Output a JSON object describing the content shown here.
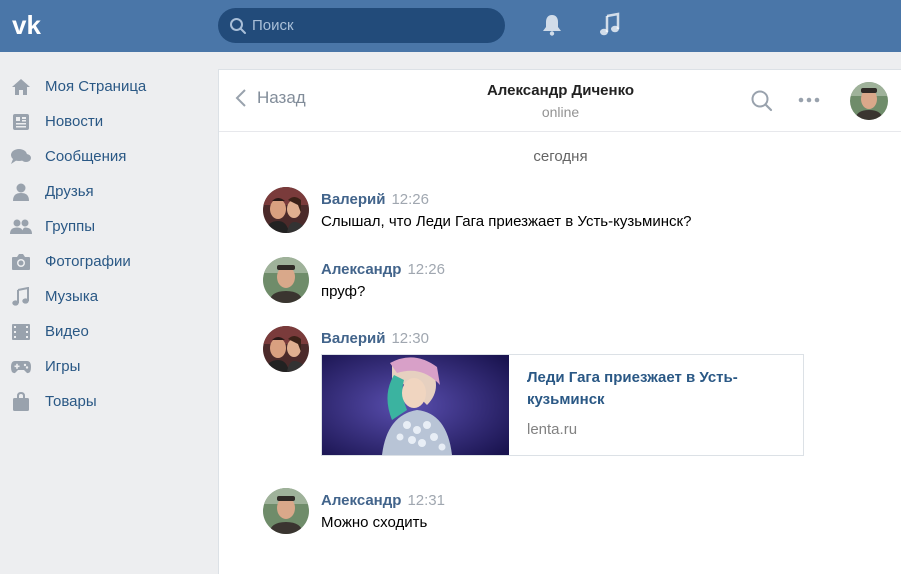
{
  "header": {
    "search_placeholder": "Поиск"
  },
  "sidebar": {
    "items": [
      {
        "label": "Моя Страница",
        "icon": "home-icon"
      },
      {
        "label": "Новости",
        "icon": "news-icon"
      },
      {
        "label": "Сообщения",
        "icon": "messages-icon"
      },
      {
        "label": "Друзья",
        "icon": "friends-icon"
      },
      {
        "label": "Группы",
        "icon": "groups-icon"
      },
      {
        "label": "Фотографии",
        "icon": "camera-icon"
      },
      {
        "label": "Музыка",
        "icon": "music-icon"
      },
      {
        "label": "Видео",
        "icon": "video-icon"
      },
      {
        "label": "Игры",
        "icon": "gamepad-icon"
      },
      {
        "label": "Товары",
        "icon": "bag-icon"
      }
    ]
  },
  "chat": {
    "back_label": "Назад",
    "peer_name": "Александр Диченко",
    "peer_status": "online",
    "date_separator": "сегодня",
    "messages": [
      {
        "author": "Валерий",
        "time": "12:26",
        "text": "Слышал, что Леди Гага приезжает в Усть-кузьминск?"
      },
      {
        "author": "Александр",
        "time": "12:26",
        "text": "пруф?"
      },
      {
        "author": "Валерий",
        "time": "12:30",
        "text": "",
        "link": {
          "title": "Леди Гага приезжает в Усть-кузьминск",
          "domain": "lenta.ru"
        }
      },
      {
        "author": "Александр",
        "time": "12:31",
        "text": "Можно сходить"
      }
    ]
  },
  "colors": {
    "header_bg": "#4a76a8",
    "search_bg": "#224b7a",
    "link_color": "#2a5885",
    "author_color": "#42648b"
  }
}
